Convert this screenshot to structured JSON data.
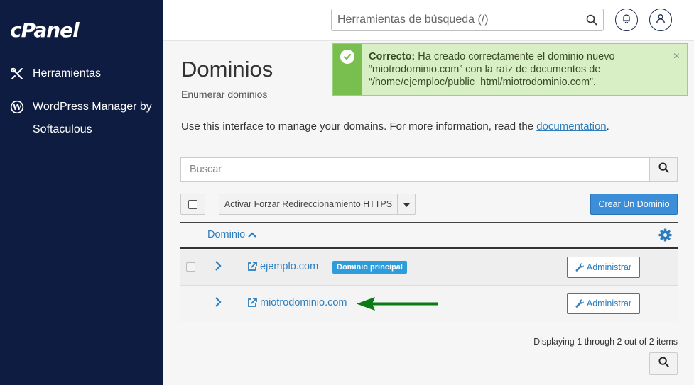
{
  "sidebar": {
    "logo": "cPanel",
    "items": [
      {
        "label": "Herramientas",
        "icon": "tools-icon"
      },
      {
        "label": "WordPress Manager by Softaculous",
        "icon": "wordpress-icon"
      }
    ]
  },
  "header": {
    "search_placeholder": "Herramientas de búsqueda (/)",
    "notifications_icon": "bell-icon",
    "user_icon": "user-icon"
  },
  "page": {
    "title": "Dominios",
    "subtitle": "Enumerar dominios",
    "intro_text": "Use this interface to manage your domains. For more information, read the ",
    "intro_link": "documentation",
    "intro_end": "."
  },
  "alert": {
    "status": "success",
    "strong": "Correcto:",
    "message": " Ha creado correctamente el dominio nuevo “miotrodominio.com” con la raíz de documentos de “/home/ejemploc/public_html/miotrodominio.com”.",
    "close": "×"
  },
  "table": {
    "search_placeholder": "Buscar",
    "https_button": "Activar Forzar Redireccionamiento HTTPS",
    "create_button": "Crear Un Dominio",
    "column_domain": "Dominio",
    "rows": [
      {
        "domain": "ejemplo.com",
        "badge": "Dominio principal",
        "action": "Administrar"
      },
      {
        "domain": "miotrodominio.com",
        "badge": "",
        "action": "Administrar"
      }
    ],
    "pagination_text": "Displaying 1 through 2 out of 2 items"
  },
  "colors": {
    "sidebar_bg": "#0d1c40",
    "link": "#2d7dbd",
    "primary_button": "#3d8ed8",
    "success_bg": "#d8efc5",
    "arrow": "#0a7a12"
  }
}
